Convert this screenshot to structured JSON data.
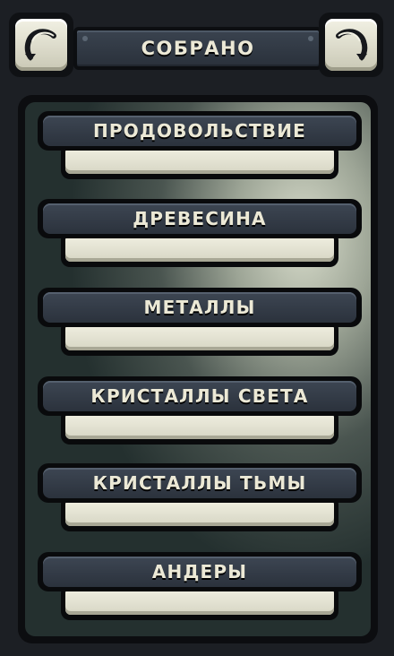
{
  "header": {
    "title": "СОБРАНО",
    "left_button_icon": "curved-arrow-left-icon",
    "right_button_icon": "curved-arrow-right-icon"
  },
  "resources": [
    {
      "label": "ПРОДОВОЛЬСТВИЕ",
      "value": ""
    },
    {
      "label": "ДРЕВЕСИНА",
      "value": ""
    },
    {
      "label": "МЕТАЛЛЫ",
      "value": ""
    },
    {
      "label": "КРИСТАЛЛЫ СВЕТА",
      "value": ""
    },
    {
      "label": "КРИСТАЛЛЫ ТЬМЫ",
      "value": ""
    },
    {
      "label": "АНДЕРЫ",
      "value": ""
    }
  ],
  "colors": {
    "label_text": "#ece9d6",
    "field_fill": "#f1f0e2",
    "frame": "#0c0d10",
    "plate": "#2b323c"
  }
}
